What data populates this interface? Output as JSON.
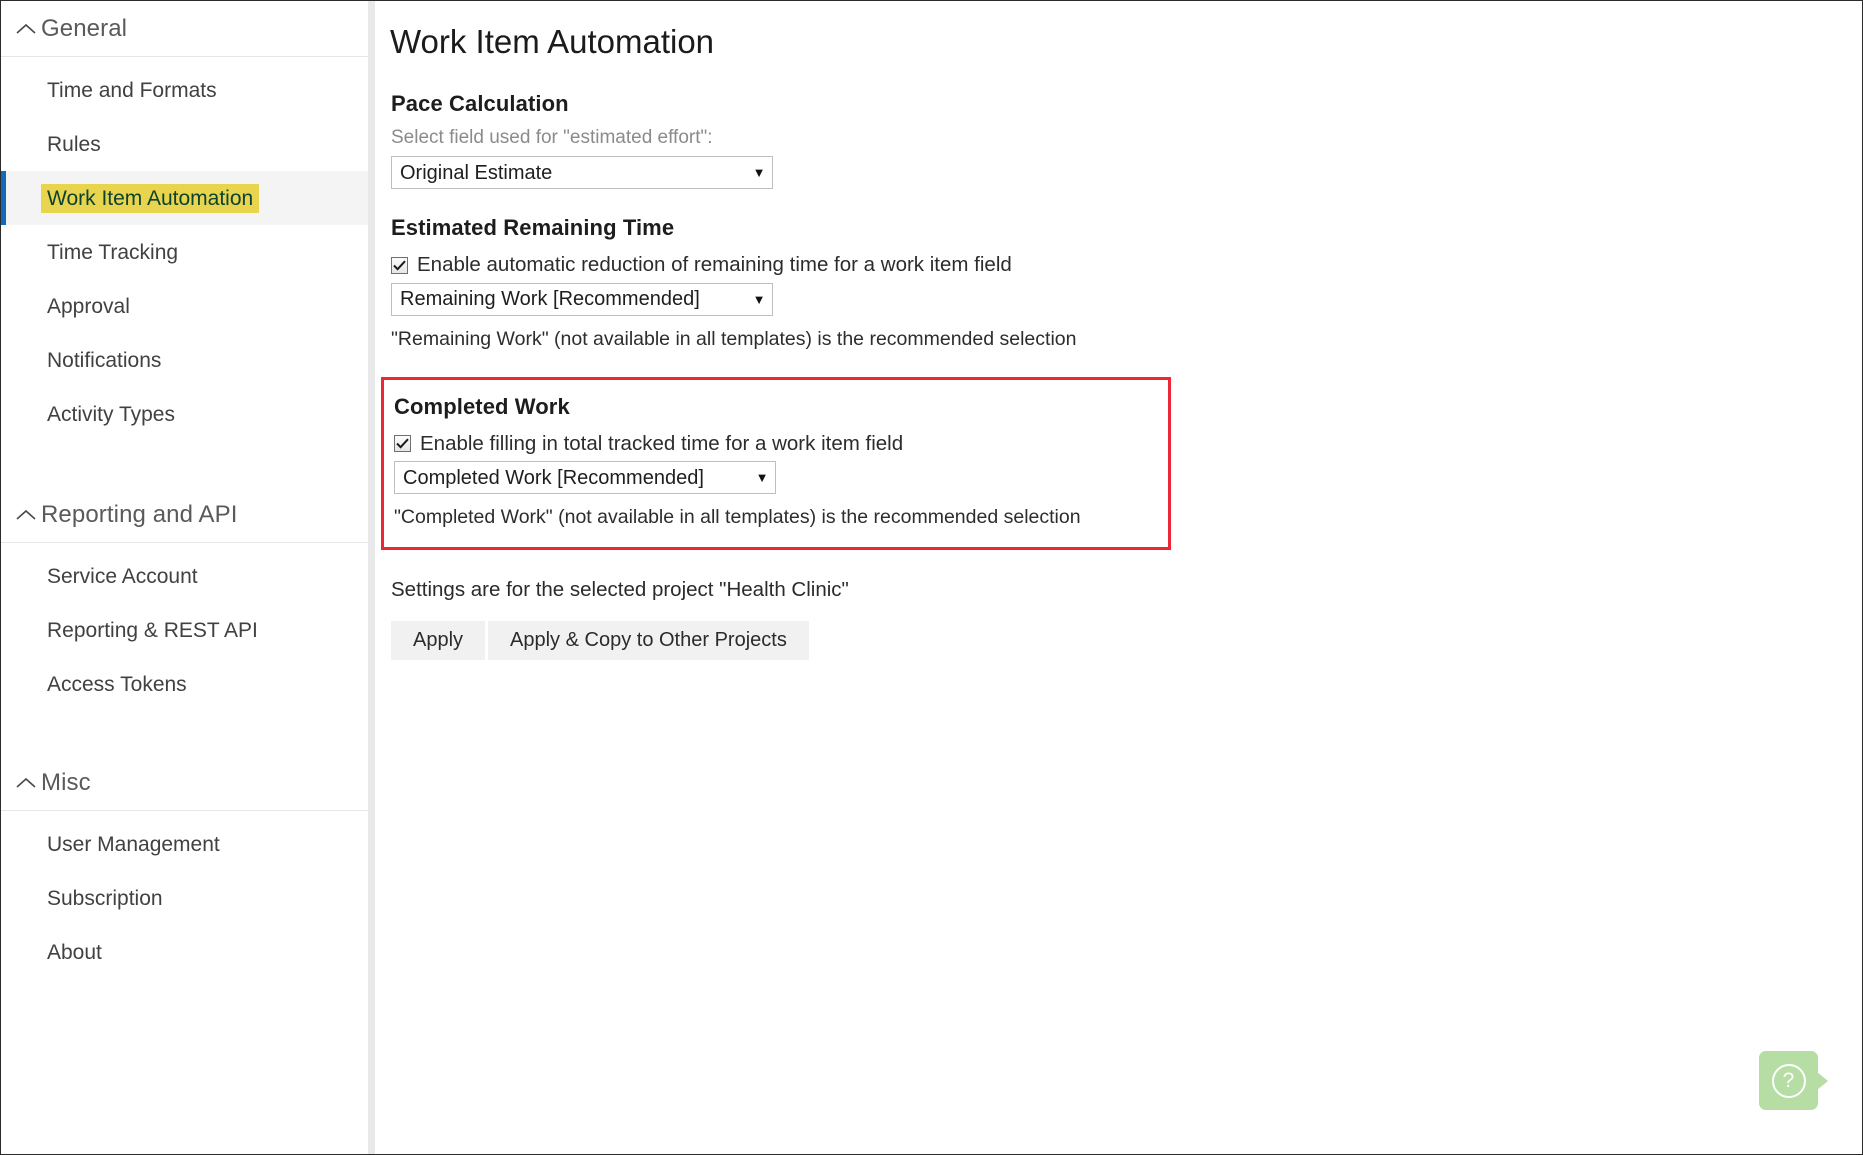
{
  "sidebar": {
    "sections": [
      {
        "id": "general",
        "label": "General",
        "icon": "chevron-up-icon",
        "items": [
          {
            "label": "Time and Formats",
            "selected": false
          },
          {
            "label": "Rules",
            "selected": false
          },
          {
            "label": "Work Item Automation",
            "selected": true
          },
          {
            "label": "Time Tracking",
            "selected": false
          },
          {
            "label": "Approval",
            "selected": false
          },
          {
            "label": "Notifications",
            "selected": false
          },
          {
            "label": "Activity Types",
            "selected": false
          }
        ]
      },
      {
        "id": "reporting",
        "label": "Reporting and API",
        "icon": "chevron-up-icon",
        "items": [
          {
            "label": "Service Account",
            "selected": false
          },
          {
            "label": "Reporting & REST API",
            "selected": false
          },
          {
            "label": "Access Tokens",
            "selected": false
          }
        ]
      },
      {
        "id": "misc",
        "label": "Misc",
        "icon": "chevron-up-icon",
        "items": [
          {
            "label": "User Management",
            "selected": false
          },
          {
            "label": "Subscription",
            "selected": false
          },
          {
            "label": "About",
            "selected": false
          }
        ]
      }
    ],
    "selected_item_bg": "#e8d44d",
    "selected_accent": "#0f6cbd"
  },
  "main": {
    "page_title": "Work Item Automation",
    "pace": {
      "heading": "Pace Calculation",
      "field_label": "Select field used for \"estimated effort\":",
      "dropdown_value": "Original Estimate",
      "caret_icon": "chevron-down-icon"
    },
    "remaining": {
      "heading": "Estimated Remaining Time",
      "checkbox_label": "Enable automatic reduction of remaining time for a work item field",
      "checkbox_checked": true,
      "dropdown_value": "Remaining Work [Recommended]",
      "hint": "\"Remaining Work\" (not available in all templates) is the recommended selection",
      "caret_icon": "chevron-down-icon"
    },
    "completed": {
      "heading": "Completed Work",
      "checkbox_label": "Enable filling in total tracked time for a work item field",
      "checkbox_checked": true,
      "dropdown_value": "Completed Work [Recommended]",
      "hint": "\"Completed Work\" (not available in all templates) is the recommended selection",
      "caret_icon": "chevron-down-icon",
      "highlight_color": "#ee2737"
    },
    "footer": {
      "project_note": "Settings are for the selected project \"Health Clinic\"",
      "apply_label": "Apply",
      "apply_copy_label": "Apply & Copy to Other Projects"
    }
  },
  "help": {
    "icon": "question-mark-icon",
    "glyph": "?",
    "color": "#b5dda4"
  }
}
